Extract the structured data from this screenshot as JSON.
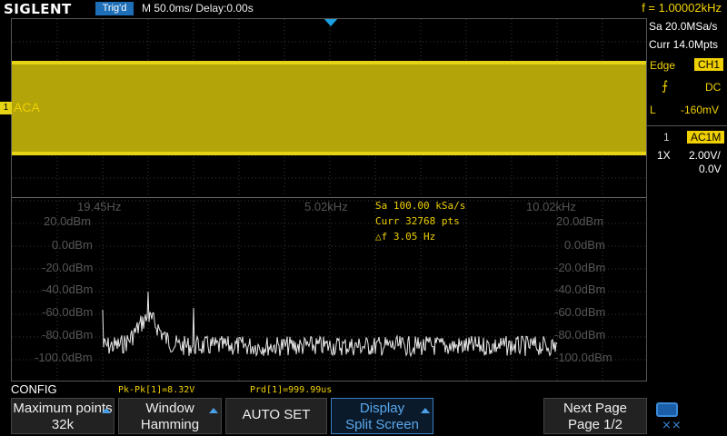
{
  "header": {
    "logo": "SIGLENT",
    "trigger_status": "Trig'd",
    "timebase": "M 50.0ms/ Delay:0.00s",
    "frequency": "f = 1.00002kHz"
  },
  "channel": {
    "marker": "1",
    "label": "ACA"
  },
  "fft": {
    "x_labels": [
      "19.45Hz",
      "5.02kHz",
      "10.02kHz"
    ],
    "y_labels_left": [
      "20.0dBm",
      "0.0dBm",
      "-20.0dBm",
      "-40.0dBm",
      "-60.0dBm",
      "-80.0dBm",
      "-100.0dBm"
    ],
    "y_labels_right": [
      "20.0dBm",
      "0.0dBm",
      "-20.0dBm",
      "-40.0dBm",
      "-60.0dBm",
      "-80.0dBm",
      "-100.0dBm"
    ],
    "info_sa": "Sa 100.00 kSa/s",
    "info_curr": "Curr 32768 pts",
    "info_df": "△f 3.05 Hz"
  },
  "right_panel": {
    "sa": "Sa 20.0MSa/s",
    "curr": "Curr 14.0Mpts",
    "trigger_type": "Edge",
    "trigger_source": "CH1",
    "slope_icon": "rising-edge-icon",
    "coupling": "DC",
    "level_label": "L",
    "level_value": "-160mV",
    "ch_number": "1",
    "ch_badge": "AC1M",
    "probe": "1X",
    "volts_div": "2.00V/",
    "offset": "0.0V"
  },
  "status": {
    "config": "CONFIG",
    "pkpk": "Pk-Pk[1]=8.32V",
    "prd": "Prd[1]=999.99us"
  },
  "softkeys": [
    {
      "line1": "Maximum points",
      "line2": "32k"
    },
    {
      "line1": "Window",
      "line2": "Hamming"
    },
    {
      "line1": "AUTO SET",
      "line2": ""
    },
    {
      "line1": "Display",
      "line2": "Split Screen"
    },
    {
      "line1": "Next Page",
      "line2": "Page 1/2"
    }
  ],
  "colors": {
    "ch1": "#f0d000",
    "accent": "#1e6fb8",
    "spectrum": "#e8e8e8"
  }
}
